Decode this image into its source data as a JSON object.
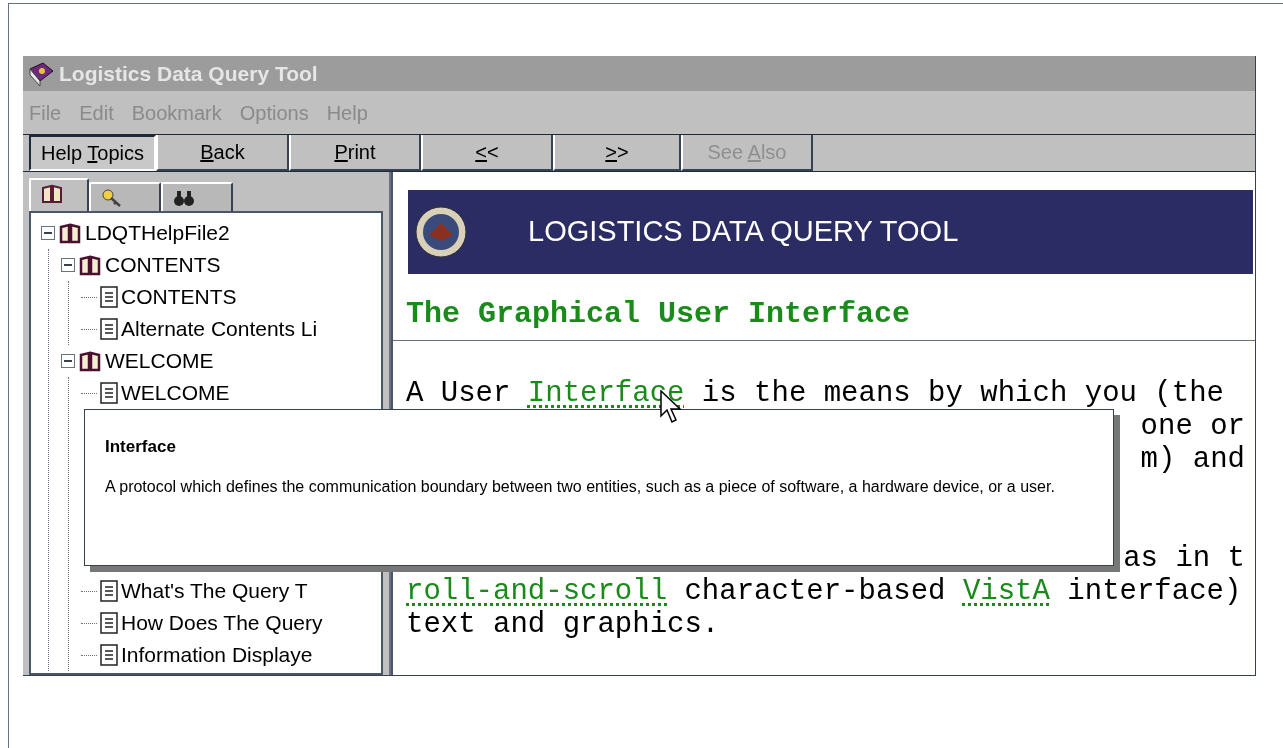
{
  "window": {
    "title": "Logistics Data Query Tool"
  },
  "menu": [
    "File",
    "Edit",
    "Bookmark",
    "Options",
    "Help"
  ],
  "toolbar": [
    {
      "before": "Help ",
      "key": "T",
      "after": "opics",
      "pressed": true,
      "disabled": false
    },
    {
      "key": "B",
      "after": "ack",
      "pressed": false,
      "disabled": false
    },
    {
      "key": "P",
      "after": "rint",
      "pressed": false,
      "disabled": false
    },
    {
      "key": "<",
      "after": "<",
      "pressed": false,
      "disabled": false
    },
    {
      "key": ">",
      "after": ">",
      "pressed": false,
      "disabled": false
    },
    {
      "before": "See ",
      "key": "A",
      "after": "lso",
      "pressed": false,
      "disabled": true
    }
  ],
  "sidebar": {
    "tabs": [
      {
        "kind": "contents",
        "selected": true
      },
      {
        "kind": "index",
        "selected": false
      },
      {
        "kind": "find",
        "selected": false
      }
    ],
    "tree": [
      {
        "kind": "book",
        "label": "LDQTHelpFile2",
        "expanded": true,
        "children": [
          {
            "kind": "book",
            "label": "CONTENTS",
            "expanded": true,
            "children": [
              {
                "kind": "page",
                "label": "CONTENTS"
              },
              {
                "kind": "page",
                "label": "Alternate Contents Li"
              }
            ]
          },
          {
            "kind": "book",
            "label": "WELCOME",
            "expanded": true,
            "children": [
              {
                "kind": "page",
                "label": "WELCOME"
              },
              {
                "kind": "gap"
              },
              {
                "kind": "page",
                "label": "What's The Query T"
              },
              {
                "kind": "page",
                "label": "How Does The Query"
              },
              {
                "kind": "page",
                "label": "Information Displaye"
              }
            ]
          }
        ]
      }
    ]
  },
  "content": {
    "banner_title": "LOGISTICS DATA QUERY TOOL",
    "heading": "The Graphical User Interface",
    "lines_above": [
      [
        {
          "text": "A User ",
          "link": false
        },
        {
          "text": "Interface",
          "link": true
        },
        {
          "text": " is the means by which you (the",
          "link": false
        }
      ]
    ],
    "line_fragments": [
      "one or",
      "m) and",
      "as in t"
    ],
    "lines_below": [
      [
        {
          "text": "roll-and-scroll",
          "link": true
        },
        {
          "text": " character-based ",
          "link": false
        },
        {
          "text": "VistA",
          "link": true
        },
        {
          "text": " interface)",
          "link": false
        }
      ],
      [
        {
          "text": "text and graphics.",
          "link": false
        }
      ]
    ]
  },
  "popup": {
    "title": "Interface",
    "text": "A protocol which defines the communication boundary between two entities, such as a piece of software, a hardware device, or a user."
  }
}
